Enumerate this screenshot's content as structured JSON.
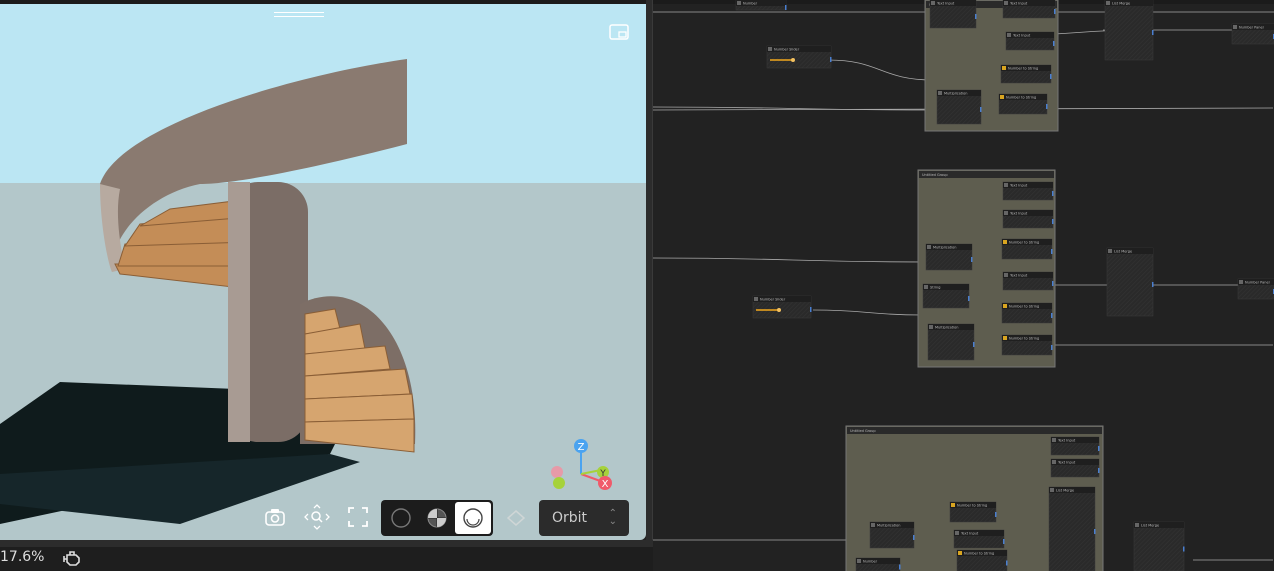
{
  "viewport": {
    "view_mode": "Orbit",
    "render_modes": [
      "wireframe",
      "shaded",
      "clay"
    ],
    "active_render_mode": "clay",
    "axes": [
      "Z",
      "Y",
      "X"
    ],
    "colors": {
      "sky": "#bbe6f3",
      "ground": "#b3c7ca",
      "wood": "#c48d57",
      "wall": "#8a7a70"
    }
  },
  "status": {
    "zoom": "17.6%"
  },
  "graph": {
    "groups": [
      "Untitled Group",
      "Untitled Group",
      "Untitled Group"
    ],
    "nodes": {
      "slider": "Number Slider",
      "text": "Text Input",
      "n2s": "Number to String",
      "mult": "Multiplication",
      "merge": "List Merge",
      "panel": "Number Panel",
      "string": "String",
      "number": "Number"
    }
  }
}
